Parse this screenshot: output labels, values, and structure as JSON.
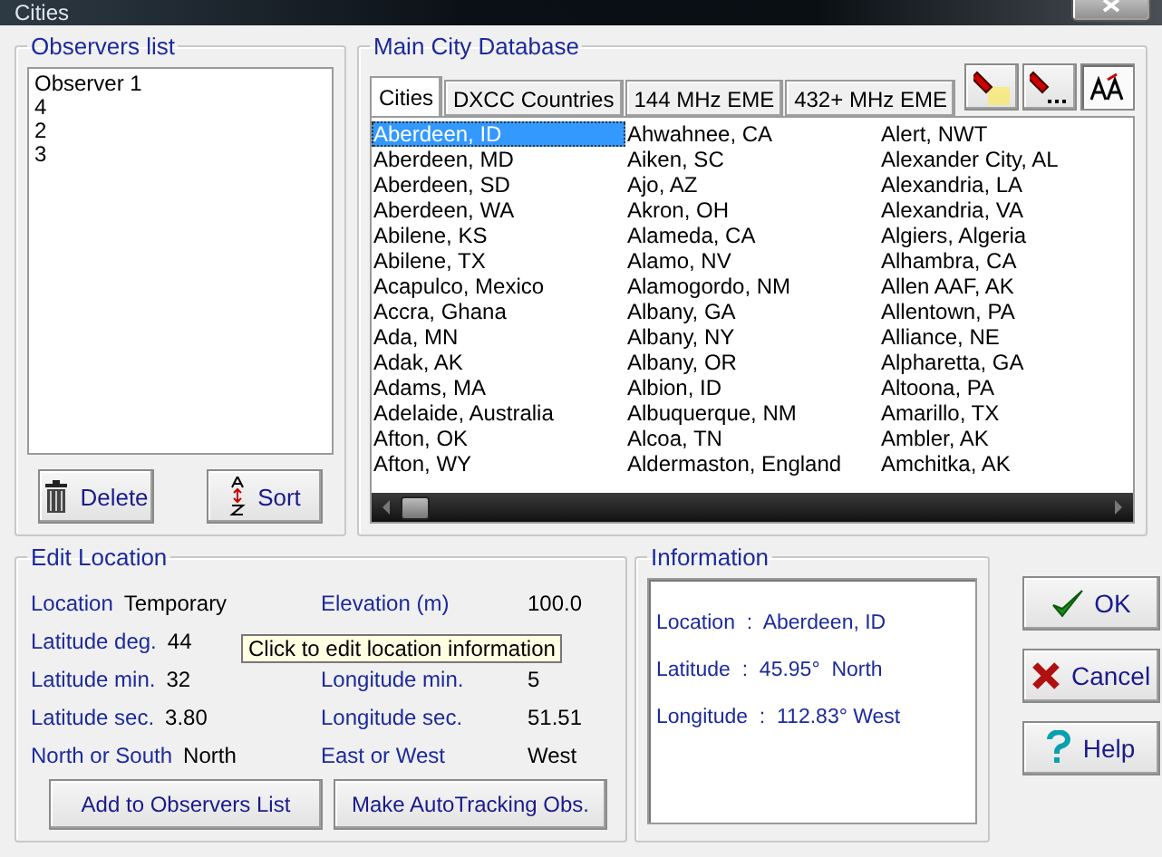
{
  "window": {
    "title": "Cities"
  },
  "observers": {
    "title": "Observers list",
    "items": [
      {
        "label": "Observer 1",
        "selected": false
      },
      {
        "label": "4",
        "selected": false
      },
      {
        "label": "2",
        "selected": false
      },
      {
        "label": "3",
        "selected": false
      }
    ],
    "buttons": [
      {
        "kind": "delete",
        "label": "Delete"
      },
      {
        "kind": "sort",
        "label": "Sort"
      }
    ]
  },
  "database": {
    "title": "Main City Database",
    "tabs": [
      {
        "label": "Cities",
        "selected": true
      },
      {
        "label": "DXCC Countries",
        "selected": false
      },
      {
        "label": "144 MHz EME",
        "selected": false
      },
      {
        "label": "432+ MHz EME",
        "selected": false
      }
    ],
    "tools": [
      {
        "kind": "find",
        "on": false
      },
      {
        "kind": "find-next",
        "on": false
      },
      {
        "kind": "font",
        "on": true
      }
    ],
    "columns": [
      [
        {
          "text": "Aberdeen, ID",
          "selected": true
        },
        {
          "text": "Aberdeen, MD",
          "selected": false
        },
        {
          "text": "Aberdeen, SD",
          "selected": false
        },
        {
          "text": "Aberdeen, WA",
          "selected": false
        },
        {
          "text": "Abilene, KS",
          "selected": false
        },
        {
          "text": "Abilene, TX",
          "selected": false
        },
        {
          "text": "Acapulco, Mexico",
          "selected": false
        },
        {
          "text": "Accra, Ghana",
          "selected": false
        },
        {
          "text": "Ada, MN",
          "selected": false
        },
        {
          "text": "Adak, AK",
          "selected": false
        },
        {
          "text": "Adams, MA",
          "selected": false
        },
        {
          "text": "Adelaide, Australia",
          "selected": false
        },
        {
          "text": "Afton, OK",
          "selected": false
        },
        {
          "text": "Afton, WY",
          "selected": false
        }
      ],
      [
        {
          "text": "Ahwahnee, CA",
          "selected": false
        },
        {
          "text": "Aiken, SC",
          "selected": false
        },
        {
          "text": "Ajo, AZ",
          "selected": false
        },
        {
          "text": "Akron, OH",
          "selected": false
        },
        {
          "text": "Alameda, CA",
          "selected": false
        },
        {
          "text": "Alamo, NV",
          "selected": false
        },
        {
          "text": "Alamogordo, NM",
          "selected": false
        },
        {
          "text": "Albany, GA",
          "selected": false
        },
        {
          "text": "Albany, NY",
          "selected": false
        },
        {
          "text": "Albany, OR",
          "selected": false
        },
        {
          "text": "Albion, ID",
          "selected": false
        },
        {
          "text": "Albuquerque, NM",
          "selected": false
        },
        {
          "text": "Alcoa, TN",
          "selected": false
        },
        {
          "text": "Aldermaston, England",
          "selected": false
        }
      ],
      [
        {
          "text": "Alert, NWT",
          "selected": false
        },
        {
          "text": "Alexander City, AL",
          "selected": false
        },
        {
          "text": "Alexandria, LA",
          "selected": false
        },
        {
          "text": "Alexandria, VA",
          "selected": false
        },
        {
          "text": "Algiers, Algeria",
          "selected": false
        },
        {
          "text": "Alhambra, CA",
          "selected": false
        },
        {
          "text": "Allen AAF, AK",
          "selected": false
        },
        {
          "text": "Allentown, PA",
          "selected": false
        },
        {
          "text": "Alliance, NE",
          "selected": false
        },
        {
          "text": "Alpharetta, GA",
          "selected": false
        },
        {
          "text": "Altoona, PA",
          "selected": false
        },
        {
          "text": "Amarillo, TX",
          "selected": false
        },
        {
          "text": "Ambler, AK",
          "selected": false
        },
        {
          "text": "Amchitka, AK",
          "selected": false
        }
      ]
    ]
  },
  "edit_location": {
    "title": "Edit Location",
    "fields": [
      {
        "kind": "field",
        "label": "Location",
        "value": "Temporary"
      },
      {
        "kind": "field",
        "label": "Elevation (m)",
        "value": "100.0"
      },
      {
        "kind": "field",
        "label": "Latitude deg.",
        "value": "44"
      },
      {
        "kind": "covered"
      },
      {
        "kind": "field",
        "label": "Latitude min.",
        "value": "32"
      },
      {
        "kind": "field",
        "label": "Longitude min.",
        "value": "5"
      },
      {
        "kind": "field",
        "label": "Latitude sec.",
        "value": "3.80"
      },
      {
        "kind": "field",
        "label": "Longitude sec.",
        "value": "51.51"
      },
      {
        "kind": "field",
        "label": "North or South",
        "value": "North"
      },
      {
        "kind": "field",
        "label": "East or West",
        "value": "West"
      }
    ],
    "tooltip": "Click to edit location information",
    "buttons": [
      "Add to Observers List",
      "Make AutoTracking Obs."
    ]
  },
  "information": {
    "title": "Information",
    "lines": [
      {
        "label": "Location",
        "separator": ":",
        "value": "Aberdeen, ID"
      },
      {
        "label": "Latitude",
        "separator": ":",
        "value": "45.95°  North"
      },
      {
        "label": "Longitude",
        "separator": ":",
        "value": "112.83° West"
      }
    ]
  },
  "dialog_buttons": [
    {
      "kind": "ok",
      "label": "OK"
    },
    {
      "kind": "cancel",
      "label": "Cancel"
    },
    {
      "kind": "help",
      "label": "Help"
    }
  ]
}
